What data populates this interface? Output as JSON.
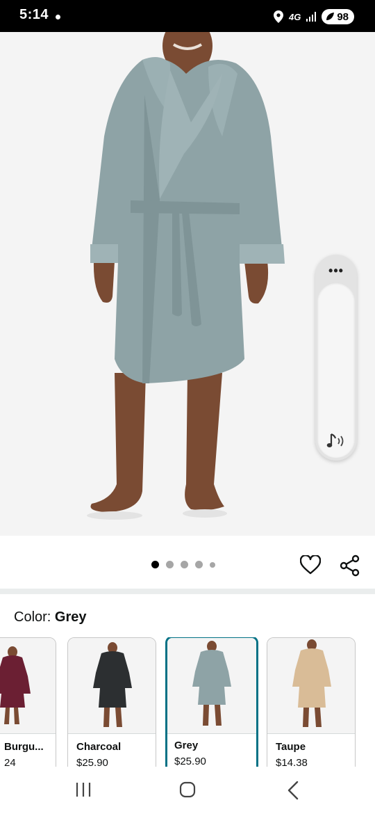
{
  "status_bar": {
    "time": "5:14",
    "network": "4G",
    "battery": "98"
  },
  "product_image": {
    "alt": "Grey hooded plush robe",
    "robe_color": "#8ea3a6"
  },
  "carousel": {
    "page_count": 5,
    "active_page": 1
  },
  "color_selector": {
    "label_prefix": "Color: ",
    "selected": "Grey",
    "swatches": [
      {
        "name": "Burgu...",
        "price": "24",
        "color": "#6b1f33"
      },
      {
        "name": "Charcoal",
        "price": "$25.90",
        "color": "#2c2f31"
      },
      {
        "name": "Grey",
        "price": "$25.90",
        "color": "#8ea3a6"
      },
      {
        "name": "Taupe",
        "price": "$14.38",
        "color": "#d9bc97"
      }
    ]
  },
  "colors": {
    "accent": "#007185",
    "background": "#f4f4f4"
  }
}
